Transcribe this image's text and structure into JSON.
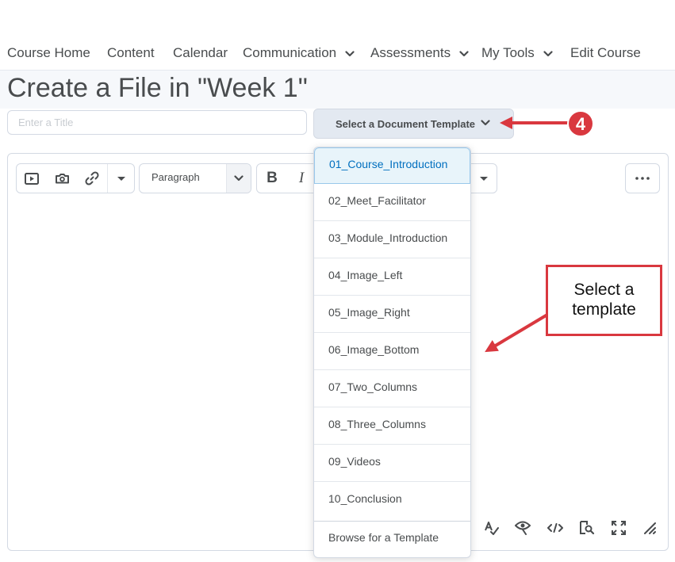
{
  "nav": {
    "items": [
      {
        "label": "Course Home",
        "dropdown": false
      },
      {
        "label": "Content",
        "dropdown": false
      },
      {
        "label": "Calendar",
        "dropdown": false
      },
      {
        "label": "Communication",
        "dropdown": true
      },
      {
        "label": "Assessments",
        "dropdown": true
      },
      {
        "label": "My Tools",
        "dropdown": true
      },
      {
        "label": "Edit Course",
        "dropdown": false
      }
    ]
  },
  "page": {
    "title": "Create a File in \"Week 1\"",
    "title_placeholder": "Enter a Title",
    "template_button": "Select a Document Template"
  },
  "editor": {
    "paragraph_select": "Paragraph",
    "bold": "B",
    "italic": "I"
  },
  "dropdown": {
    "selected_index": 0,
    "items": [
      "01_Course_Introduction",
      "02_Meet_Facilitator",
      "03_Module_Introduction",
      "04_Image_Left",
      "05_Image_Right",
      "06_Image_Bottom",
      "07_Two_Columns",
      "08_Three_Columns",
      "09_Videos",
      "10_Conclusion"
    ],
    "footer": "Browse for a Template"
  },
  "annotations": {
    "step_number": "4",
    "callout_line1": "Select a",
    "callout_line2": "template",
    "annotation_color": "#d9383f"
  },
  "colors": {
    "text": "#494c4e",
    "selected_text": "#006fbf",
    "selected_bg": "#e8f4fa",
    "button_bg": "#e3e9f1"
  }
}
